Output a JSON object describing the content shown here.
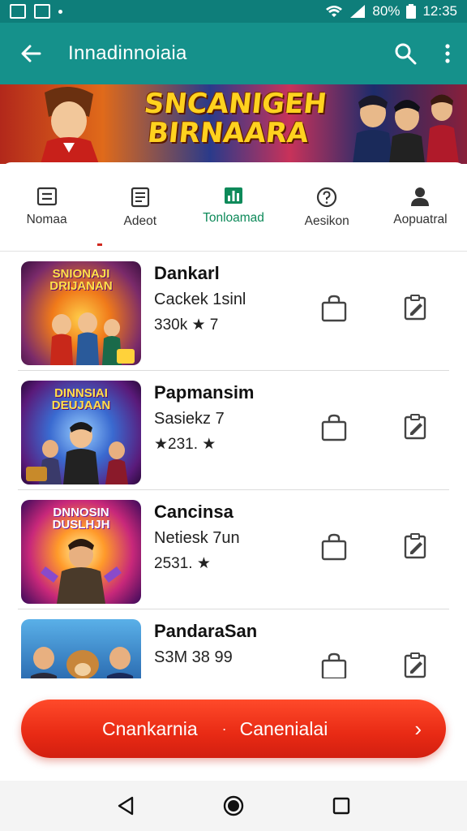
{
  "status_bar": {
    "battery": "80%",
    "time": "12:35"
  },
  "app_bar": {
    "title": "Innadinnoiaia"
  },
  "banner": {
    "title_line1": "SNCANIGEH",
    "title_line2": "BIRNAARA"
  },
  "tabs": [
    {
      "label": "Nomaa",
      "icon": "book-icon"
    },
    {
      "label": "Adeot",
      "icon": "document-icon"
    },
    {
      "label": "Tonloamad",
      "icon": "leaderboard-icon",
      "active": true
    },
    {
      "label": "Aesikon",
      "icon": "question-icon"
    },
    {
      "label": "Aopuatral",
      "icon": "person-icon"
    }
  ],
  "games": [
    {
      "name": "Dankarl",
      "subtitle": "Cackek 1sinl",
      "rating": "330k ★ 7",
      "thumb_label": "SNIONAJI DRIJANAN"
    },
    {
      "name": "Papmansim",
      "subtitle": "Sasiekz 7",
      "rating": "★231. ★",
      "thumb_label": "DINNSIAI DEUJAAN"
    },
    {
      "name": "Cancinsa",
      "subtitle": "Netiesk 7un",
      "rating": "2531. ★",
      "thumb_label": "DNNOSIN DUSLHJH"
    },
    {
      "name": "PandaraSan",
      "subtitle": "S3M 38 99",
      "rating": "",
      "thumb_label": ""
    }
  ],
  "cta": {
    "left_label": "Cnankarnia",
    "separator": "·",
    "right_label": "Canenialai",
    "chevron": "›"
  },
  "colors": {
    "app_bar": "#15918b",
    "status_bar": "#0e7e7a",
    "active_tab": "#0e8a5a",
    "cta": "#e82a14"
  }
}
